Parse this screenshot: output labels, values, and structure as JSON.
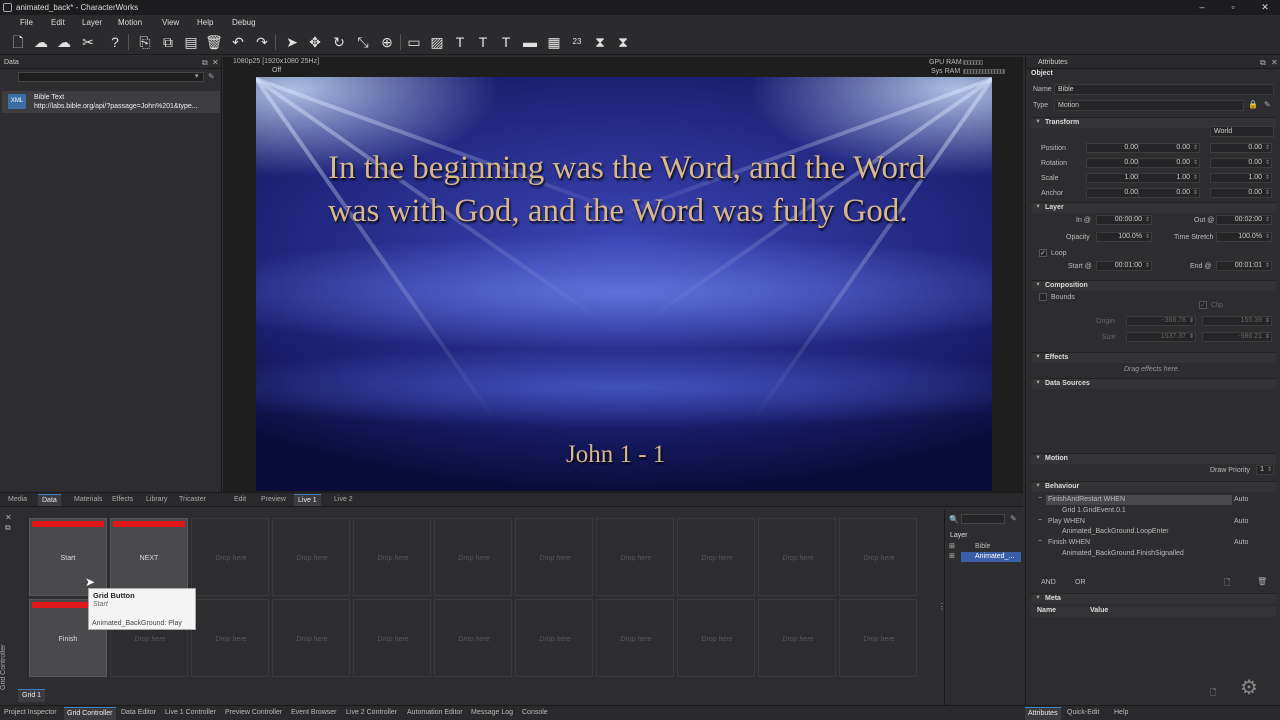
{
  "window": {
    "title": "animated_back* - CharacterWorks"
  },
  "menu": [
    "File",
    "Edit",
    "Layer",
    "Motion",
    "View",
    "Help",
    "Debug"
  ],
  "toolbar": {
    "icons": [
      "new-icon",
      "cloud-upload-icon",
      "cloud-download-icon",
      "tools-icon",
      "help-icon",
      "cut-icon",
      "copy-icon",
      "paste-icon",
      "delete-icon",
      "undo-icon",
      "redo-icon",
      "select-arrow-icon",
      "move-icon",
      "rotate-icon",
      "scale-icon",
      "anchor-icon",
      "rectangle-icon",
      "image-icon",
      "text-icon",
      "text-plus-icon",
      "text-edit-icon",
      "bar-icon",
      "counter-icon",
      "calendar-icon",
      "clock-icon",
      "timer-icon"
    ],
    "calendar_day": "23"
  },
  "data_panel": {
    "title": "Data",
    "item": {
      "name": "Bible Text",
      "url": "http://labs.bible.org/api/?passage=John%201&type...",
      "icon_label": "XML"
    }
  },
  "viewer": {
    "format": "1080p25 [1920x1080 25Hz]",
    "status": "Off",
    "gpu_label": "GPU RAM",
    "sys_label": "Sys RAM",
    "verse": "In the beginning was the Word, and the Word was with God, and the Word was fully God.",
    "reference": "John 1 - 1"
  },
  "left_tabs": [
    "Media",
    "Data",
    "Materials",
    "Effects",
    "Library",
    "Tricaster"
  ],
  "left_tabs_active": "Data",
  "view_tabs": [
    "Edit",
    "Preview",
    "Live 1",
    "Live 2"
  ],
  "view_tabs_active": "Live 1",
  "attributes": {
    "panel_title": "Attributes",
    "object_section": "Object",
    "name_label": "Name",
    "name_value": "Bible",
    "type_label": "Type",
    "type_value": "Motion",
    "transform": {
      "title": "Transform",
      "space": "World",
      "rows": [
        {
          "label": "Position",
          "v": [
            "0.00",
            "0.00",
            "0.00"
          ]
        },
        {
          "label": "Rotation",
          "v": [
            "0.00",
            "0.00",
            "0.00"
          ]
        },
        {
          "label": "Scale",
          "v": [
            "1.00",
            "1.00",
            "1.00"
          ]
        },
        {
          "label": "Anchor",
          "v": [
            "0.00",
            "0.00",
            "0.00"
          ]
        }
      ]
    },
    "layer": {
      "title": "Layer",
      "in_label": "In @",
      "in_value": "00:00:00",
      "out_label": "Out @",
      "out_value": "00:02:00",
      "opacity_label": "Opacity",
      "opacity_value": "100.0%",
      "stretch_label": "Time Stretch",
      "stretch_value": "100.0%",
      "loop_label": "Loop",
      "start_label": "Start @",
      "start_value": "00:01:00",
      "end_label": "End @",
      "end_value": "00:01:01"
    },
    "composition": {
      "title": "Composition",
      "bounds_label": "Bounds",
      "clip_label": "Clip",
      "origin_label": "Origin",
      "origin_values": [
        "-366.78",
        "155.39"
      ],
      "size_label": "Size",
      "size_values": [
        "1537.37",
        "-986.21"
      ]
    },
    "effects": {
      "title": "Effects",
      "hint": "Drag effects here."
    },
    "data_sources": {
      "title": "Data Sources"
    },
    "motion": {
      "title": "Motion",
      "draw_priority_label": "Draw Priority",
      "draw_priority_value": "1"
    },
    "behaviour": {
      "title": "Behaviour",
      "rows": [
        {
          "text": "FinishAndRestart WHEN",
          "mode": "Auto",
          "indent": 0,
          "selected": true
        },
        {
          "text": "Grid 1.GridEvent.0.1",
          "mode": "",
          "indent": 1
        },
        {
          "text": "Play WHEN",
          "mode": "Auto",
          "indent": 0
        },
        {
          "text": "Animated_BackGround.LoopEnter",
          "mode": "",
          "indent": 1
        },
        {
          "text": "Finish WHEN",
          "mode": "Auto",
          "indent": 0
        },
        {
          "text": "Animated_BackGround.FinishSignalled",
          "mode": "",
          "indent": 1
        }
      ],
      "and_label": "AND",
      "or_label": "OR"
    },
    "meta": {
      "title": "Meta",
      "col_name": "Name",
      "col_value": "Value"
    }
  },
  "grid": {
    "side_label": "Grid Controller",
    "tab": "Grid 1",
    "drop_text": "Drop here",
    "buttons": [
      {
        "label": "Start",
        "row": 0,
        "col": 0
      },
      {
        "label": "NEXT",
        "row": 0,
        "col": 1
      },
      {
        "label": "Finish",
        "row": 1,
        "col": 0
      }
    ],
    "tooltip": {
      "title": "Grid Button",
      "subtitle": "Start",
      "action": "Animated_BackGround: Play"
    }
  },
  "layers": {
    "header": "Layer",
    "items": [
      {
        "name": "Bible",
        "selected": false
      },
      {
        "name": "Animated_...",
        "selected": true
      }
    ]
  },
  "status_tabs_left": [
    "Project Inspector",
    "Grid Controller",
    "Data Editor",
    "Live 1 Controller",
    "Preview Controller",
    "Event Browser",
    "Live 2 Controller",
    "Automation Editor",
    "Message Log",
    "Console"
  ],
  "status_active_left": "Grid Controller",
  "status_tabs_right": [
    "Attributes",
    "Quick-Edit",
    "Help"
  ],
  "status_active_right": "Attributes"
}
